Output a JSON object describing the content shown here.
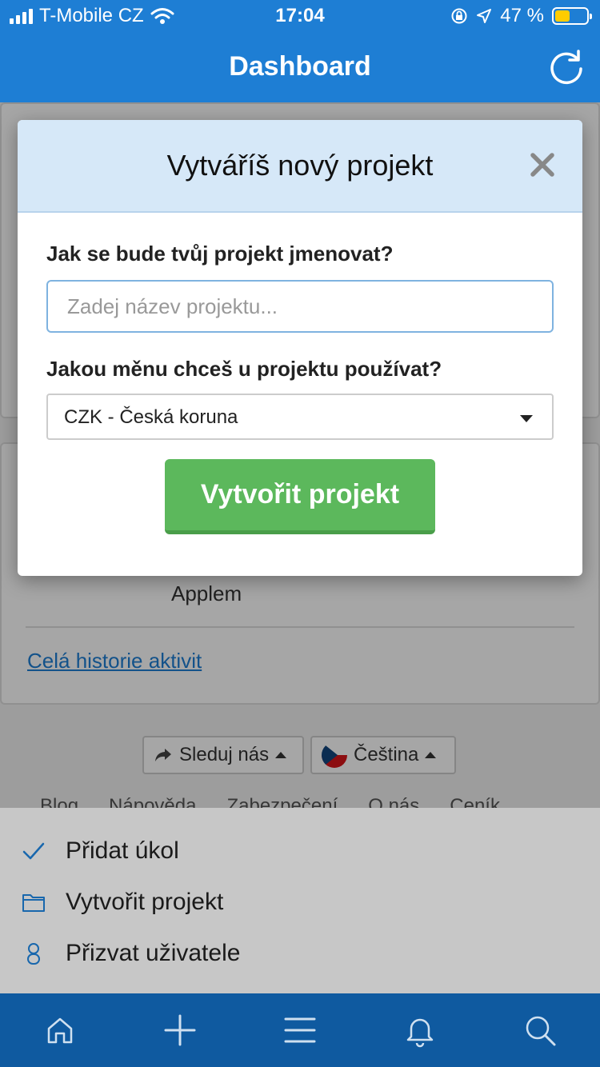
{
  "status": {
    "carrier": "T-Mobile CZ",
    "time": "17:04",
    "battery_percent": "47 %",
    "battery_level": 0.47,
    "battery_color": "#ffcc00"
  },
  "header": {
    "title": "Dashboard",
    "refresh_icon": "refresh-icon"
  },
  "modal": {
    "title": "Vytváříš nový projekt",
    "name_label": "Jak se bude tvůj projekt jmenovat?",
    "name_value": "",
    "name_placeholder": "Zadej název projektu...",
    "currency_label": "Jakou měnu chceš u projektu používat?",
    "currency_selected": "CZK - Česká koruna",
    "create_button": "Vytvořit projekt"
  },
  "background": {
    "activity_text": "Applem",
    "history_link": "Celá historie aktivit",
    "follow_button": "Sleduj nás",
    "language_button": "Čeština",
    "footer_links": [
      "Blog",
      "Nápověda",
      "Zabezpečení",
      "O nás",
      "Ceník"
    ]
  },
  "action_sheet": {
    "items": [
      {
        "label": "Přidat úkol",
        "icon": "check-icon"
      },
      {
        "label": "Vytvořit projekt",
        "icon": "folder-icon"
      },
      {
        "label": "Přizvat uživatele",
        "icon": "user-icon"
      }
    ]
  },
  "tabbar": {
    "tabs": [
      "home-icon",
      "plus-icon",
      "menu-icon",
      "bell-icon",
      "search-icon"
    ]
  },
  "colors": {
    "primary": "#1e7ed4",
    "tabbar": "#0f5aa0",
    "success": "#5cb85c",
    "modal_header": "#d6e8f8"
  }
}
